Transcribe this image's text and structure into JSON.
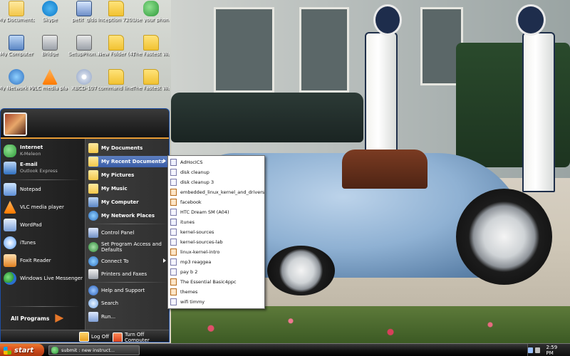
{
  "desktop_icons": [
    {
      "label": "My Documents",
      "icon": "my-documents-icon"
    },
    {
      "label": "Skype",
      "icon": "skype-icon"
    },
    {
      "label": "petit_glds",
      "icon": "file-icon"
    },
    {
      "label": "Inception 720...",
      "icon": "folder-icon"
    },
    {
      "label": "Use your phone's int...",
      "icon": "frog-icon"
    },
    {
      "label": "My Computer",
      "icon": "my-computer-icon"
    },
    {
      "label": "Bridge",
      "icon": "bridge-icon"
    },
    {
      "label": "SetupPhon...",
      "icon": "setup-icon"
    },
    {
      "label": "New Folder (4)",
      "icon": "folder-icon"
    },
    {
      "label": "The Fastest Way to B...",
      "icon": "folder-icon"
    },
    {
      "label": "My Network Places",
      "icon": "network-icon"
    },
    {
      "label": "VLC media player",
      "icon": "vlc-icon"
    },
    {
      "label": "XBCD-107",
      "icon": "cd-icon"
    },
    {
      "label": "command line - Lifehacker_F...",
      "icon": "folder-icon"
    },
    {
      "label": "The Fastest Way to B...",
      "icon": "folder-icon"
    }
  ],
  "start_menu": {
    "pinned": [
      {
        "title": "Internet",
        "subtitle": "K-Meleon",
        "icon": "k-meleon-icon"
      },
      {
        "title": "E-mail",
        "subtitle": "Outlook Express",
        "icon": "outlook-express-icon"
      }
    ],
    "recent_programs": [
      {
        "label": "Notepad",
        "icon": "notepad-icon"
      },
      {
        "label": "VLC media player",
        "icon": "vlc-icon"
      },
      {
        "label": "WordPad",
        "icon": "wordpad-icon"
      },
      {
        "label": "iTunes",
        "icon": "itunes-icon"
      },
      {
        "label": "Foxit Reader",
        "icon": "foxit-reader-icon"
      },
      {
        "label": "Windows Live Messenger",
        "icon": "messenger-icon"
      }
    ],
    "all_programs_label": "All Programs",
    "places": [
      {
        "label": "My Documents",
        "icon": "my-documents-icon"
      },
      {
        "label": "My Recent Documents",
        "icon": "recent-documents-icon"
      },
      {
        "label": "My Pictures",
        "icon": "my-pictures-icon"
      },
      {
        "label": "My Music",
        "icon": "my-music-icon"
      },
      {
        "label": "My Computer",
        "icon": "my-computer-icon"
      },
      {
        "label": "My Network Places",
        "icon": "network-icon"
      }
    ],
    "system": [
      {
        "label": "Control Panel",
        "icon": "control-panel-icon"
      },
      {
        "label": "Set Program Access and Defaults",
        "icon": "program-access-icon"
      },
      {
        "label": "Connect To",
        "icon": "connect-icon"
      },
      {
        "label": "Printers and Faxes",
        "icon": "printer-icon"
      }
    ],
    "help": [
      {
        "label": "Help and Support",
        "icon": "help-icon"
      },
      {
        "label": "Search",
        "icon": "search-icon"
      },
      {
        "label": "Run...",
        "icon": "run-icon"
      }
    ],
    "log_off_label": "Log Off",
    "turn_off_label": "Turn Off Computer"
  },
  "recent_documents": [
    {
      "label": "AdHocICS",
      "type": "doc"
    },
    {
      "label": "disk cleanup",
      "type": "txt"
    },
    {
      "label": "disk cleanup 3",
      "type": "txt"
    },
    {
      "label": "embedded_linux_kernel_and_drivers",
      "type": "wmp"
    },
    {
      "label": "facebook",
      "type": "wmp"
    },
    {
      "label": "HTC Dream SM (A04)",
      "type": "txt"
    },
    {
      "label": "itunes",
      "type": "doc"
    },
    {
      "label": "kernel-sources",
      "type": "txt"
    },
    {
      "label": "kernel-sources-lab",
      "type": "txt"
    },
    {
      "label": "linux-kernel-intro",
      "type": "wmp"
    },
    {
      "label": "mp3 reaggea",
      "type": "txt"
    },
    {
      "label": "pay b 2",
      "type": "txt"
    },
    {
      "label": "The Essential Basic4ppc",
      "type": "wmp"
    },
    {
      "label": "themes",
      "type": "wmp"
    },
    {
      "label": "wifi timmy",
      "type": "txt"
    }
  ],
  "taskbar": {
    "start_label": "start",
    "task_label": "submit : new instruct...",
    "clock": "2:59 PM"
  },
  "colors": {
    "accent_orange": "#e79b34",
    "start_button": "#d9521f",
    "highlight_blue": "#3b5ea8"
  }
}
